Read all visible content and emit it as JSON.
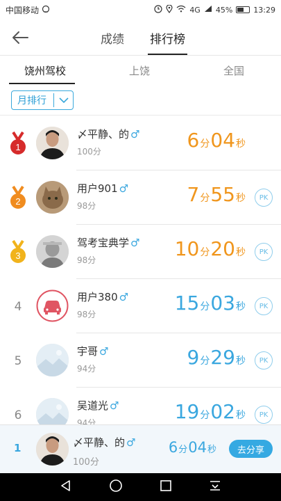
{
  "status_bar": {
    "carrier": "中国移动",
    "right_text": "4G",
    "battery_percent": "45%",
    "time": "13:29"
  },
  "header": {
    "tabs": [
      {
        "label": "成绩"
      },
      {
        "label": "排行榜"
      }
    ]
  },
  "scope_tabs": [
    {
      "label": "饶州驾校"
    },
    {
      "label": "上饶"
    },
    {
      "label": "全国"
    }
  ],
  "filter": {
    "label": "月排行"
  },
  "units": {
    "min": "分",
    "sec": "秒",
    "male": "♂",
    "pk": "PK"
  },
  "ranking": [
    {
      "rank": "1",
      "name": "〆平静、的",
      "score": "100分",
      "minutes": "6",
      "seconds": "04",
      "color": "#f0961d",
      "medal": "#d62b2b"
    },
    {
      "rank": "2",
      "name": "用户901",
      "score": "98分",
      "minutes": "7",
      "seconds": "55",
      "color": "#f0961d",
      "medal": "#f08c1f"
    },
    {
      "rank": "3",
      "name": "驾考宝典学",
      "score": "98分",
      "minutes": "10",
      "seconds": "20",
      "color": "#f0961d",
      "medal": "#f1b31c"
    },
    {
      "rank": "4",
      "name": "用户380",
      "score": "98分",
      "minutes": "15",
      "seconds": "03",
      "color": "#3aa7df"
    },
    {
      "rank": "5",
      "name": "宇哥",
      "score": "94分",
      "minutes": "9",
      "seconds": "29",
      "color": "#3aa7df"
    },
    {
      "rank": "6",
      "name": "吴道光",
      "score": "94分",
      "minutes": "19",
      "seconds": "02",
      "color": "#3aa7df"
    }
  ],
  "my_rank": {
    "rank": "1",
    "name": "〆平静、的",
    "score": "100分",
    "minutes": "6",
    "seconds": "04",
    "share_label": "去分享"
  }
}
